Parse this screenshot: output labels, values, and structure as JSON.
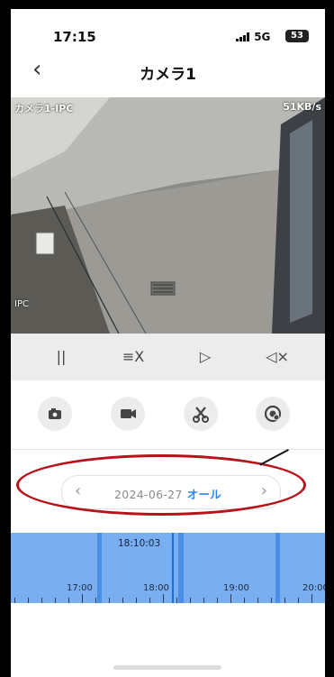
{
  "status": {
    "time": "17:15",
    "signal": "5G",
    "battery": "53"
  },
  "nav": {
    "back": "‹",
    "title": "カメラ1"
  },
  "video": {
    "camera_label": "カメラ1-IPC",
    "bitrate": "51KB/s",
    "corner_label": "IPC"
  },
  "controls": {
    "pause": "||",
    "speed": "≡X",
    "play": "▷",
    "mute": "◁×"
  },
  "actions": [
    {
      "name": "snapshot",
      "icon": "camera-icon"
    },
    {
      "name": "record",
      "icon": "video-icon"
    },
    {
      "name": "clip",
      "icon": "scissors-icon"
    },
    {
      "name": "talk",
      "icon": "talk-icon"
    }
  ],
  "date": {
    "prev": "‹",
    "value": "2024-06-27",
    "filter": "オール",
    "next": "›"
  },
  "timeline": {
    "current_time": "18:10:03",
    "labels": [
      "17:00",
      "18:00",
      "19:00",
      "20:00"
    ]
  },
  "colors": {
    "accent": "#2e86f0",
    "timeline": "#79aef0",
    "annotation": "#b8121a"
  }
}
